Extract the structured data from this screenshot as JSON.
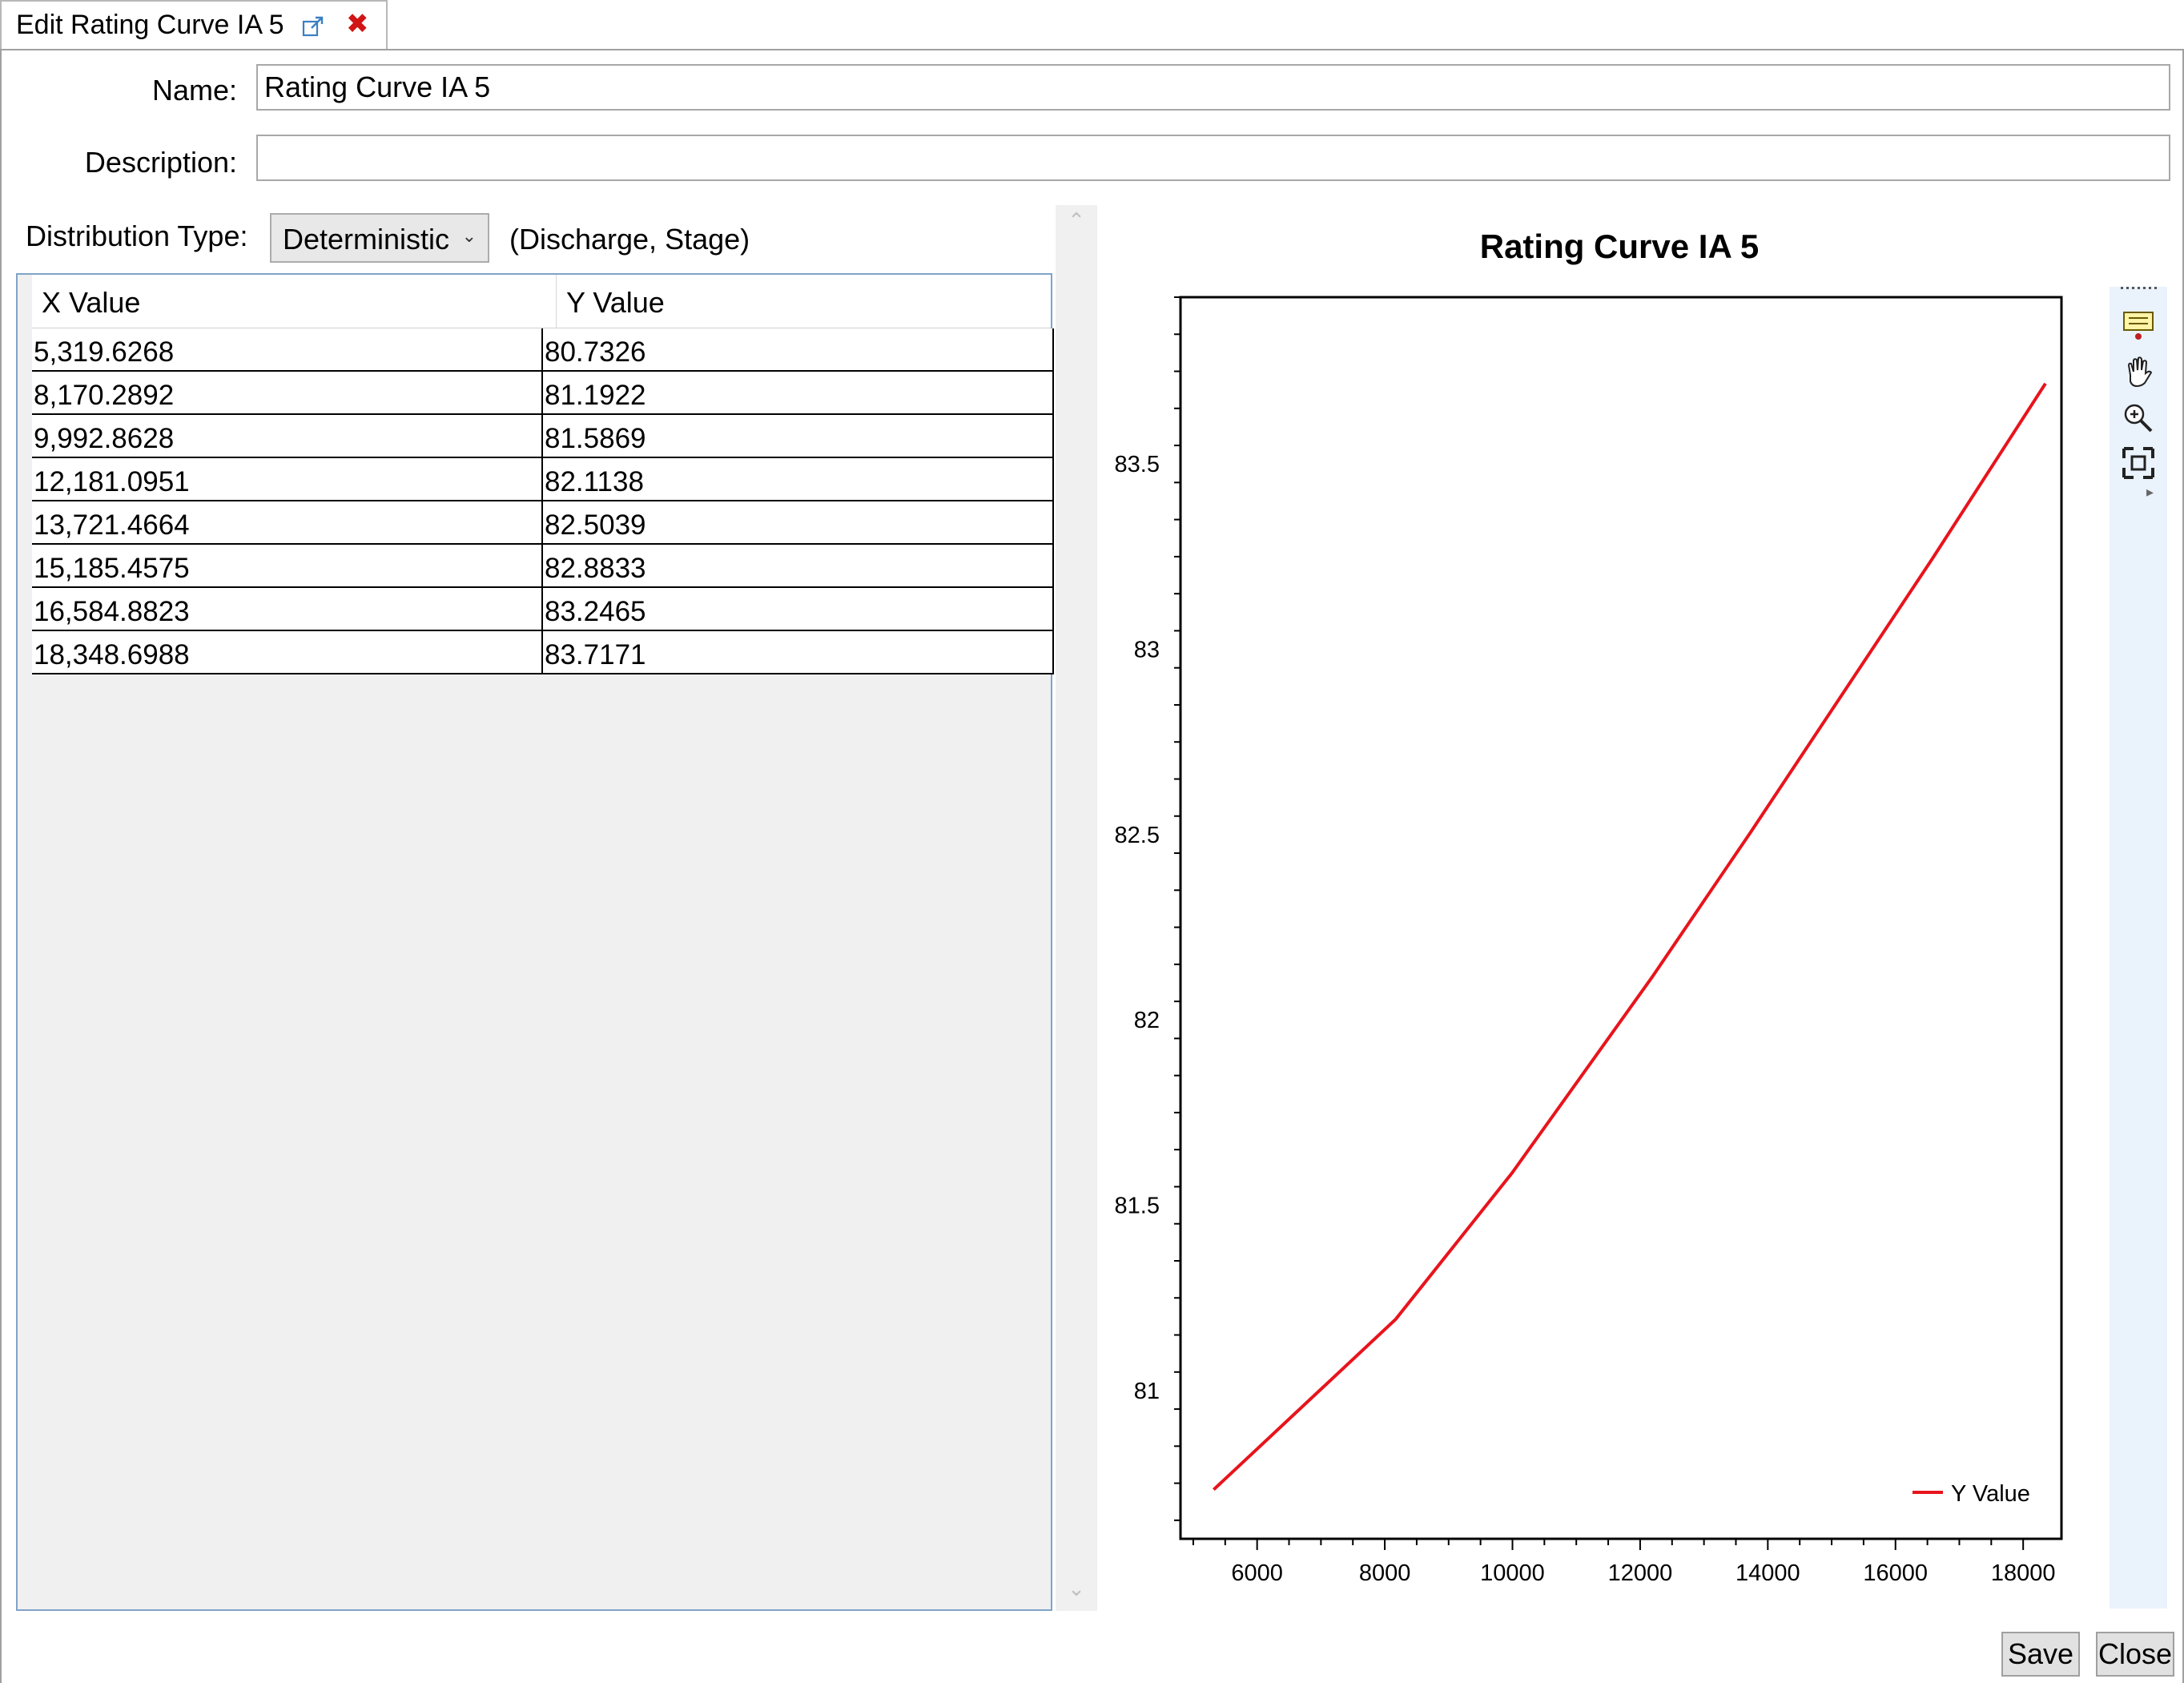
{
  "tab": {
    "title": "Edit Rating Curve IA 5"
  },
  "form": {
    "name_label": "Name:",
    "name_value": "Rating Curve IA 5",
    "description_label": "Description:",
    "description_value": "",
    "distribution_label": "Distribution Type:",
    "distribution_value": "Deterministic",
    "distribution_hint": "(Discharge, Stage)"
  },
  "table": {
    "columns": [
      "X Value",
      "Y Value"
    ],
    "rows": [
      [
        "5,319.6268",
        "80.7326"
      ],
      [
        "8,170.2892",
        "81.1922"
      ],
      [
        "9,992.8628",
        "81.5869"
      ],
      [
        "12,181.0951",
        "82.1138"
      ],
      [
        "13,721.4664",
        "82.5039"
      ],
      [
        "15,185.4575",
        "82.8833"
      ],
      [
        "16,584.8823",
        "83.2465"
      ],
      [
        "18,348.6988",
        "83.7171"
      ]
    ]
  },
  "chart_data": {
    "type": "line",
    "title": "Rating Curve IA 5",
    "xlabel": "",
    "ylabel": "",
    "xlim": [
      4800,
      18600
    ],
    "ylim": [
      80.6,
      83.95
    ],
    "xticks": [
      6000,
      8000,
      10000,
      12000,
      14000,
      16000,
      18000
    ],
    "yticks": [
      81,
      81.5,
      82,
      82.5,
      83,
      83.5
    ],
    "grid": false,
    "legend": "bottom-right",
    "series": [
      {
        "name": "Y Value",
        "color": "#e8141c",
        "x": [
          5319.6268,
          8170.2892,
          9992.8628,
          12181.0951,
          13721.4664,
          15185.4575,
          16584.8823,
          18348.6988
        ],
        "y": [
          80.7326,
          81.1922,
          81.5869,
          82.1138,
          82.5039,
          82.8833,
          83.2465,
          83.7171
        ]
      }
    ]
  },
  "toolbar": {
    "icons": [
      "annotation-icon",
      "pan-hand-icon",
      "zoom-icon",
      "fit-extents-icon"
    ]
  },
  "buttons": {
    "save": "Save",
    "close": "Close"
  }
}
